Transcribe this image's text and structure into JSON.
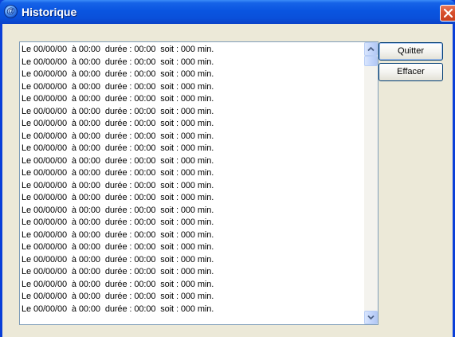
{
  "window": {
    "title": "Historique",
    "icon": "at-sign-icon",
    "icon_glyph": "@"
  },
  "list": {
    "items": [
      "Le 00/00/00  à 00:00  durée : 00:00  soit : 000 min.",
      "Le 00/00/00  à 00:00  durée : 00:00  soit : 000 min.",
      "Le 00/00/00  à 00:00  durée : 00:00  soit : 000 min.",
      "Le 00/00/00  à 00:00  durée : 00:00  soit : 000 min.",
      "Le 00/00/00  à 00:00  durée : 00:00  soit : 000 min.",
      "Le 00/00/00  à 00:00  durée : 00:00  soit : 000 min.",
      "Le 00/00/00  à 00:00  durée : 00:00  soit : 000 min.",
      "Le 00/00/00  à 00:00  durée : 00:00  soit : 000 min.",
      "Le 00/00/00  à 00:00  durée : 00:00  soit : 000 min.",
      "Le 00/00/00  à 00:00  durée : 00:00  soit : 000 min.",
      "Le 00/00/00  à 00:00  durée : 00:00  soit : 000 min.",
      "Le 00/00/00  à 00:00  durée : 00:00  soit : 000 min.",
      "Le 00/00/00  à 00:00  durée : 00:00  soit : 000 min.",
      "Le 00/00/00  à 00:00  durée : 00:00  soit : 000 min.",
      "Le 00/00/00  à 00:00  durée : 00:00  soit : 000 min.",
      "Le 00/00/00  à 00:00  durée : 00:00  soit : 000 min.",
      "Le 00/00/00  à 00:00  durée : 00:00  soit : 000 min.",
      "Le 00/00/00  à 00:00  durée : 00:00  soit : 000 min.",
      "Le 00/00/00  à 00:00  durée : 00:00  soit : 000 min.",
      "Le 00/00/00  à 00:00  durée : 00:00  soit : 000 min.",
      "Le 00/00/00  à 00:00  durée : 00:00  soit : 000 min.",
      "Le 00/00/00  à 00:00  durée : 00:00  soit : 000 min."
    ]
  },
  "buttons": {
    "quit_label": "Quitter",
    "clear_label": "Effacer"
  },
  "colors": {
    "titlebar": "#0a55e0",
    "close_button": "#d8502e",
    "dialog_background": "#ece9d8",
    "list_border": "#7f9db9"
  }
}
